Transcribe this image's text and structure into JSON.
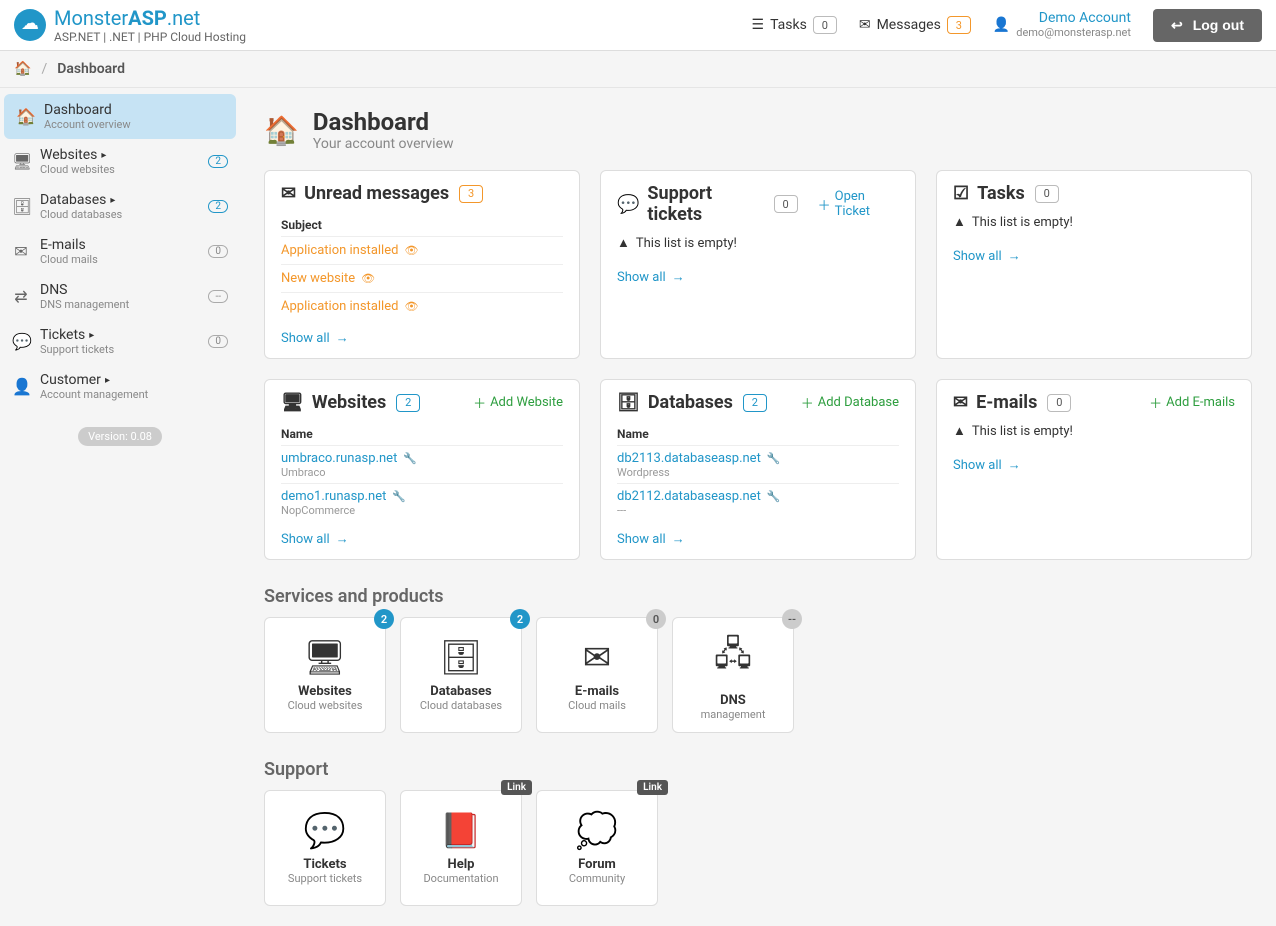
{
  "brand": {
    "name_p1": "Monster",
    "name_p2": "ASP",
    "name_p3": ".net",
    "tag": "ASP.NET | .NET | PHP Cloud Hosting"
  },
  "topbar": {
    "tasks_label": "Tasks",
    "tasks_count": "0",
    "messages_label": "Messages",
    "messages_count": "3",
    "account_name": "Demo Account",
    "account_email": "demo@monsterasp.net",
    "logout_label": "Log out"
  },
  "breadcrumb": {
    "current": "Dashboard"
  },
  "sidebar": {
    "items": [
      {
        "title": "Dashboard",
        "sub": "Account overview",
        "badge": ""
      },
      {
        "title": "Websites",
        "sub": "Cloud websites",
        "badge": "2"
      },
      {
        "title": "Databases",
        "sub": "Cloud databases",
        "badge": "2"
      },
      {
        "title": "E-mails",
        "sub": "Cloud mails",
        "badge": "0"
      },
      {
        "title": "DNS",
        "sub": "DNS management",
        "badge": "--"
      },
      {
        "title": "Tickets",
        "sub": "Support tickets",
        "badge": "0"
      },
      {
        "title": "Customer",
        "sub": "Account management",
        "badge": ""
      }
    ],
    "version": "Version: 0.08"
  },
  "page": {
    "title": "Dashboard",
    "sub": "Your account overview"
  },
  "panels": {
    "messages": {
      "title": "Unread messages",
      "count": "3",
      "col": "Subject",
      "rows": [
        {
          "subject": "Application installed"
        },
        {
          "subject": "New website"
        },
        {
          "subject": "Application installed"
        }
      ],
      "showall": "Show all"
    },
    "tickets": {
      "title": "Support tickets",
      "count": "0",
      "open": "Open Ticket",
      "empty": "This list is empty!",
      "showall": "Show all"
    },
    "tasks": {
      "title": "Tasks",
      "count": "0",
      "empty": "This list is empty!",
      "showall": "Show all"
    },
    "websites": {
      "title": "Websites",
      "count": "2",
      "add": "Add Website",
      "col": "Name",
      "rows": [
        {
          "name": "umbraco.runasp.net",
          "sub": "Umbraco"
        },
        {
          "name": "demo1.runasp.net",
          "sub": "NopCommerce"
        }
      ],
      "showall": "Show all"
    },
    "databases": {
      "title": "Databases",
      "count": "2",
      "add": "Add Database",
      "col": "Name",
      "rows": [
        {
          "name": "db2113.databaseasp.net",
          "sub": "Wordpress"
        },
        {
          "name": "db2112.databaseasp.net",
          "sub": "---"
        }
      ],
      "showall": "Show all"
    },
    "emails": {
      "title": "E-mails",
      "count": "0",
      "add": "Add E-mails",
      "empty": "This list is empty!",
      "showall": "Show all"
    }
  },
  "services": {
    "heading": "Services and products",
    "tiles": [
      {
        "title": "Websites",
        "sub": "Cloud websites",
        "badge": "2",
        "badgeClass": ""
      },
      {
        "title": "Databases",
        "sub": "Cloud databases",
        "badge": "2",
        "badgeClass": ""
      },
      {
        "title": "E-mails",
        "sub": "Cloud mails",
        "badge": "0",
        "badgeClass": "gray"
      },
      {
        "title": "DNS",
        "sub": "management",
        "badge": "--",
        "badgeClass": "gray"
      }
    ]
  },
  "support": {
    "heading": "Support",
    "tiles": [
      {
        "title": "Tickets",
        "sub": "Support tickets",
        "link": ""
      },
      {
        "title": "Help",
        "sub": "Documentation",
        "link": "Link"
      },
      {
        "title": "Forum",
        "sub": "Community",
        "link": "Link"
      }
    ]
  }
}
